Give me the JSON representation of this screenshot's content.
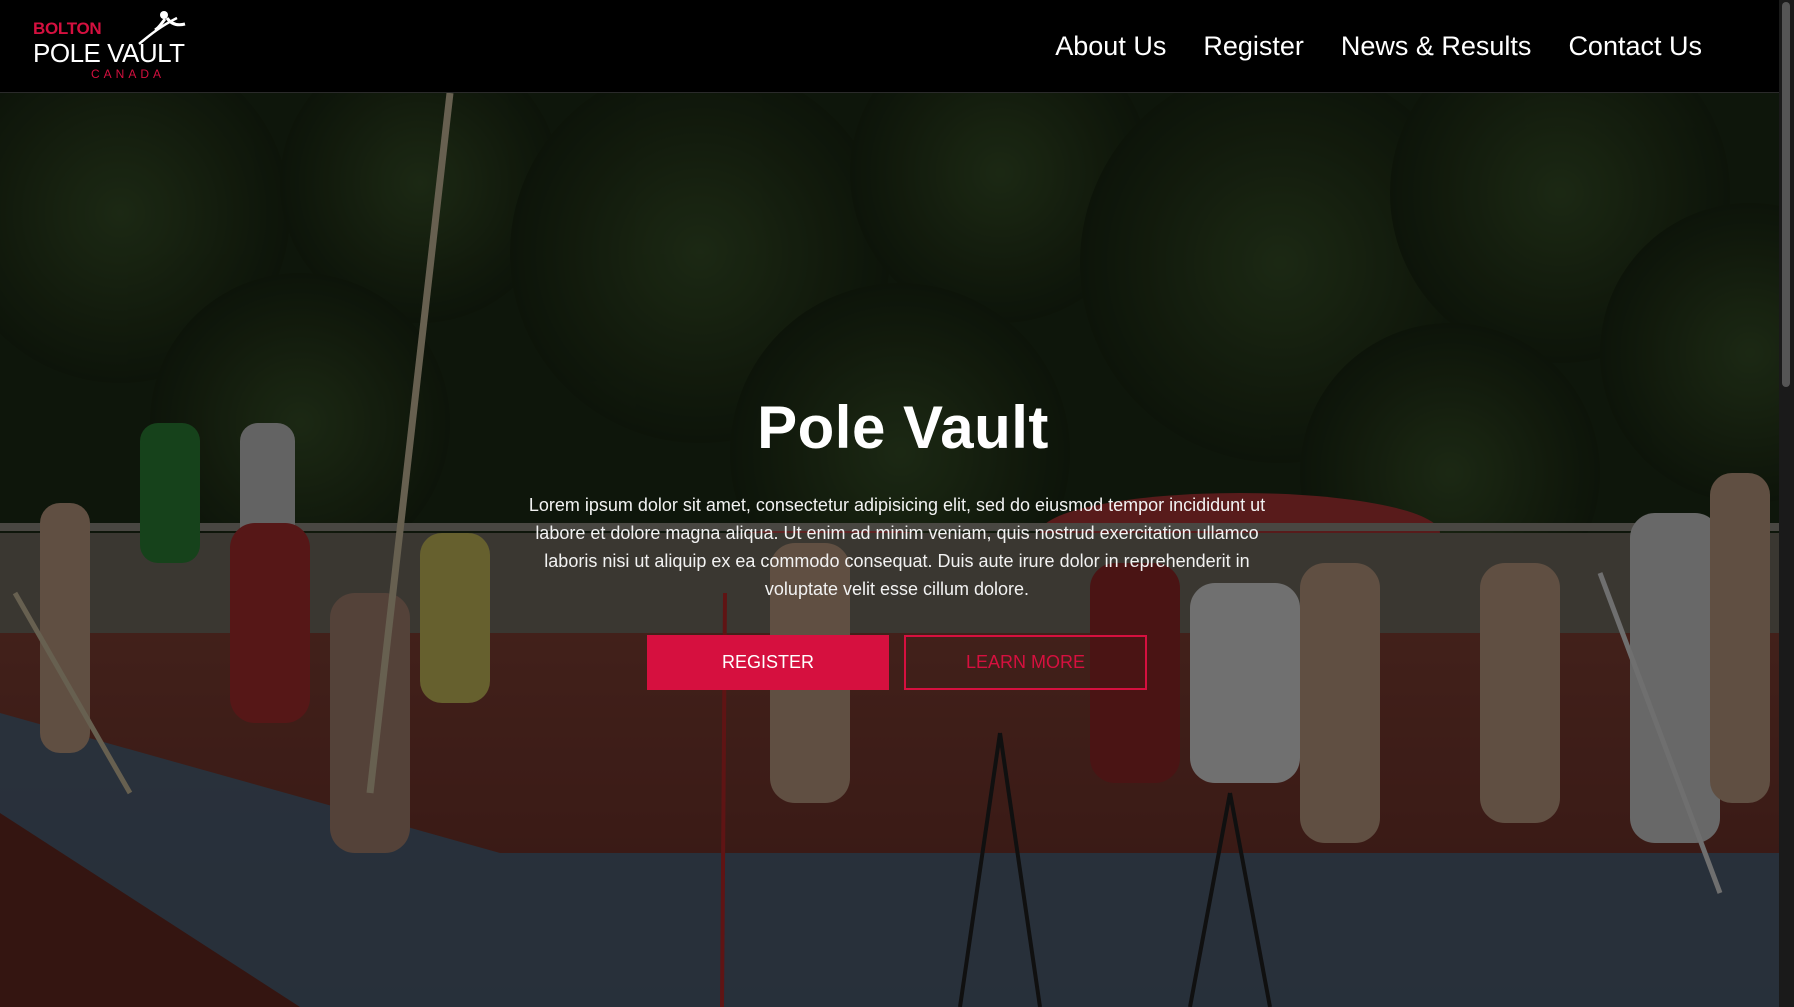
{
  "logo": {
    "top_text": "BOLTON",
    "main_text": "POLE VAULT",
    "sub_text": "CANADA"
  },
  "nav": {
    "items": [
      "About Us",
      "Register",
      "News & Results",
      "Contact Us"
    ]
  },
  "hero": {
    "title": "Pole Vault",
    "body": "Lorem ipsum dolor sit amet, consectetur adipisicing elit, sed do eiusmod tempor incididunt ut labore et dolore magna aliqua. Ut enim ad minim veniam, quis nostrud exercitation ullamco laboris nisi ut aliquip ex ea commodo consequat. Duis aute irure dolor in reprehenderit in voluptate velit esse cillum dolore.",
    "primary_button": "Register",
    "secondary_button": "Learn More"
  },
  "colors": {
    "accent": "#d6103f",
    "header_bg": "#000000"
  }
}
